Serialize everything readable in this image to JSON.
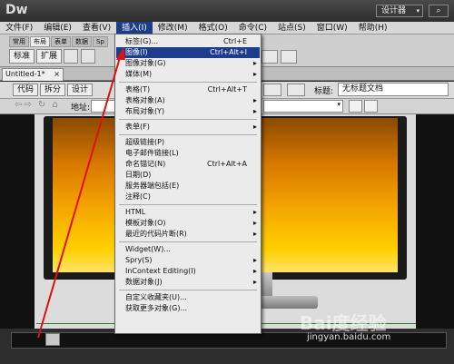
{
  "app": {
    "logo": "Dw",
    "workspace": "设计器",
    "workspace_arrow": "▾",
    "search_icon": "search-icon"
  },
  "menubar": [
    {
      "label": "文件(F)"
    },
    {
      "label": "编辑(E)"
    },
    {
      "label": "查看(V)"
    },
    {
      "label": "插入(I)",
      "active": true
    },
    {
      "label": "修改(M)"
    },
    {
      "label": "格式(O)"
    },
    {
      "label": "命令(C)"
    },
    {
      "label": "站点(S)"
    },
    {
      "label": "窗口(W)"
    },
    {
      "label": "帮助(H)"
    }
  ],
  "insert_panel": {
    "tabs": [
      "常用",
      "布局",
      "表单",
      "数据",
      "Sp"
    ],
    "selected_tab": "布局",
    "buttons": [
      "标准",
      "扩展"
    ]
  },
  "document": {
    "tab_label": "Untitled-1*",
    "close": "×"
  },
  "view_toolbar": {
    "buttons": [
      "代码",
      "拆分",
      "设计"
    ],
    "title_label": "标题:",
    "title_value": "无标题文档"
  },
  "address_bar": {
    "nav": "⇦⇨ ↻ ⌂",
    "label": "地址:",
    "dropdown_arrow": "▾"
  },
  "insert_menu": {
    "items": [
      {
        "label": "标签(G)...",
        "shortcut": "Ctrl+E",
        "submenu": false
      },
      {
        "label": "图像(I)",
        "shortcut": "Ctrl+Alt+I",
        "submenu": false,
        "highlighted": true
      },
      {
        "label": "图像对象(G)",
        "shortcut": "",
        "submenu": true
      },
      {
        "label": "媒体(M)",
        "shortcut": "",
        "submenu": true
      },
      {
        "sep": true
      },
      {
        "label": "表格(T)",
        "shortcut": "Ctrl+Alt+T",
        "submenu": false
      },
      {
        "label": "表格对象(A)",
        "shortcut": "",
        "submenu": true
      },
      {
        "label": "布局对象(Y)",
        "shortcut": "",
        "submenu": true
      },
      {
        "sep": true
      },
      {
        "label": "表单(F)",
        "shortcut": "",
        "submenu": true
      },
      {
        "sep": true
      },
      {
        "label": "超级链接(P)",
        "shortcut": "",
        "submenu": false
      },
      {
        "label": "电子邮件链接(L)",
        "shortcut": "",
        "submenu": false
      },
      {
        "label": "命名锚记(N)",
        "shortcut": "Ctrl+Alt+A",
        "submenu": false
      },
      {
        "label": "日期(D)",
        "shortcut": "",
        "submenu": false
      },
      {
        "label": "服务器端包括(E)",
        "shortcut": "",
        "submenu": false
      },
      {
        "label": "注释(C)",
        "shortcut": "",
        "submenu": false
      },
      {
        "sep": true
      },
      {
        "label": "HTML",
        "shortcut": "",
        "submenu": true
      },
      {
        "label": "模板对象(O)",
        "shortcut": "",
        "submenu": true
      },
      {
        "label": "最近的代码片断(R)",
        "shortcut": "",
        "submenu": true
      },
      {
        "sep": true
      },
      {
        "label": "Widget(W)...",
        "shortcut": "",
        "submenu": false
      },
      {
        "label": "Spry(S)",
        "shortcut": "",
        "submenu": true
      },
      {
        "label": "InContext Editing(I)",
        "shortcut": "",
        "submenu": true
      },
      {
        "label": "数据对象(J)",
        "shortcut": "",
        "submenu": true
      },
      {
        "sep": true
      },
      {
        "label": "自定义收藏夹(U)...",
        "shortcut": "",
        "submenu": false
      },
      {
        "label": "获取更多对象(G)...",
        "shortcut": "",
        "submenu": false
      }
    ]
  },
  "watermark": {
    "brand": "Bai度经验",
    "url": "jingyan.baidu.com"
  },
  "colors": {
    "menu_highlight": "#1e3c8c",
    "arrow": "#e01010"
  }
}
